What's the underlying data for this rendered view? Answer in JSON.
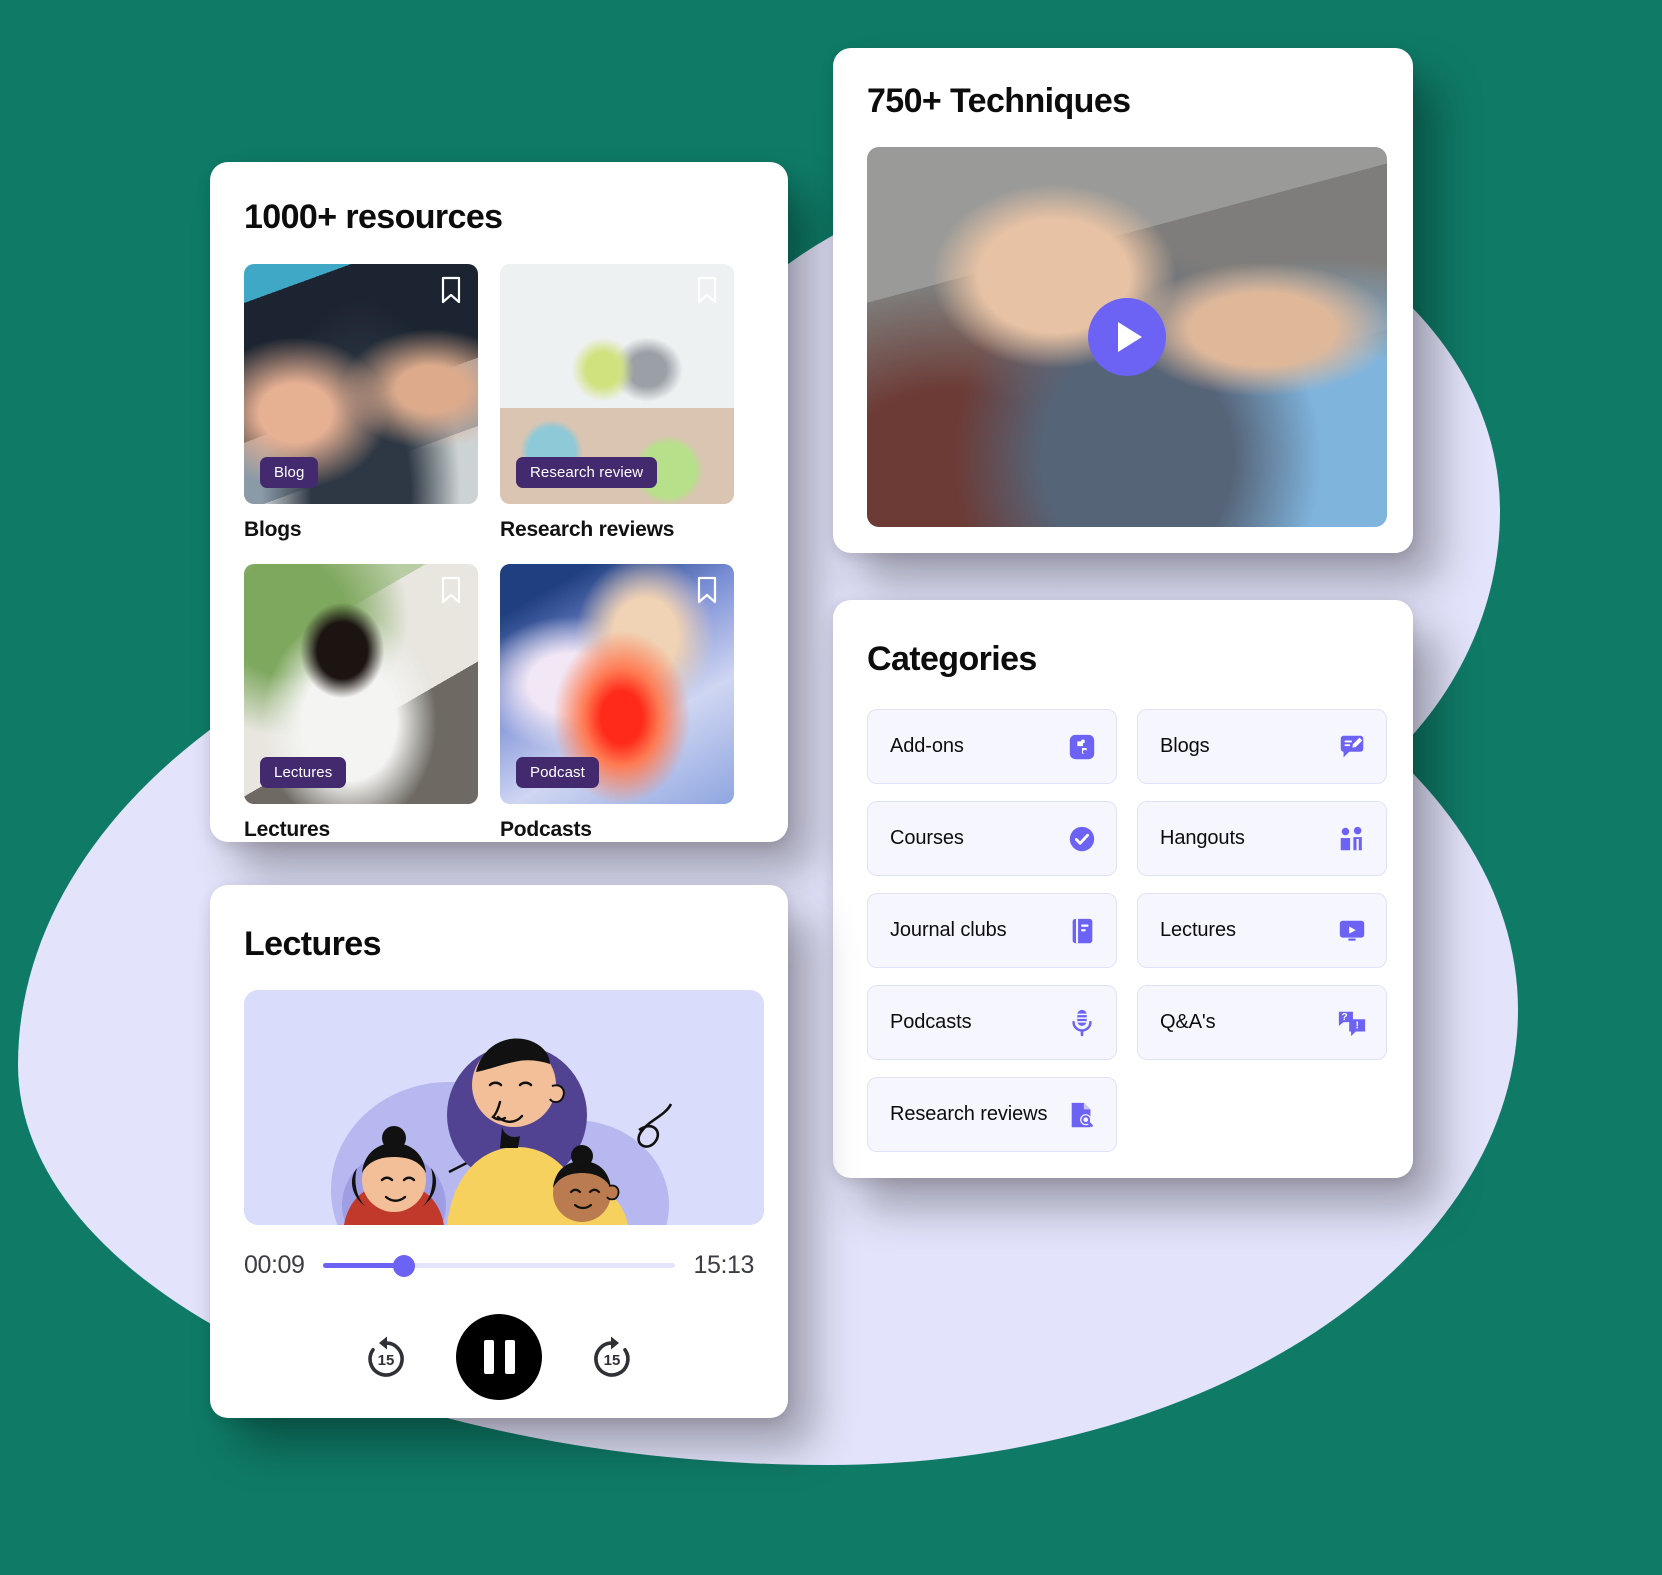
{
  "theme": {
    "accent": "#6c63f5",
    "badge_bg": "#43296e",
    "blob_bg": "#e3e3fb",
    "card_bg": "#ffffff",
    "tile_bg": "#f5f6fe",
    "tile_border": "#dfe3fa",
    "page_bg": "#0f7b67"
  },
  "resources": {
    "title": "1000+ resources",
    "items": [
      {
        "badge": "Blog",
        "name": "Blogs",
        "bookmark_icon": "bookmark-icon"
      },
      {
        "badge": "Research review",
        "name": "Research reviews",
        "bookmark_icon": "bookmark-icon"
      },
      {
        "badge": "Lectures",
        "name": "Lectures",
        "bookmark_icon": "bookmark-icon"
      },
      {
        "badge": "Podcast",
        "name": "Podcasts",
        "bookmark_icon": "bookmark-icon"
      }
    ]
  },
  "techniques": {
    "title": "750+ Techniques",
    "play_icon": "play-icon"
  },
  "categories": {
    "title": "Categories",
    "items": [
      {
        "label": "Add-ons",
        "icon": "puzzle-icon"
      },
      {
        "label": "Blogs",
        "icon": "chat-pencil-icon"
      },
      {
        "label": "Courses",
        "icon": "check-circle-icon"
      },
      {
        "label": "Hangouts",
        "icon": "people-icon"
      },
      {
        "label": "Journal clubs",
        "icon": "book-icon"
      },
      {
        "label": "Lectures",
        "icon": "monitor-play-icon"
      },
      {
        "label": "Podcasts",
        "icon": "microphone-icon"
      },
      {
        "label": "Q&A's",
        "icon": "question-chat-icon"
      },
      {
        "label": "Research reviews",
        "icon": "document-search-icon"
      }
    ]
  },
  "player": {
    "title": "Lectures",
    "current_time": "00:09",
    "total_time": "15:13",
    "progress_percent": 23,
    "rewind_label": "15",
    "forward_label": "15",
    "rewind_icon": "rewind-15-icon",
    "forward_icon": "forward-15-icon",
    "pause_icon": "pause-icon"
  }
}
